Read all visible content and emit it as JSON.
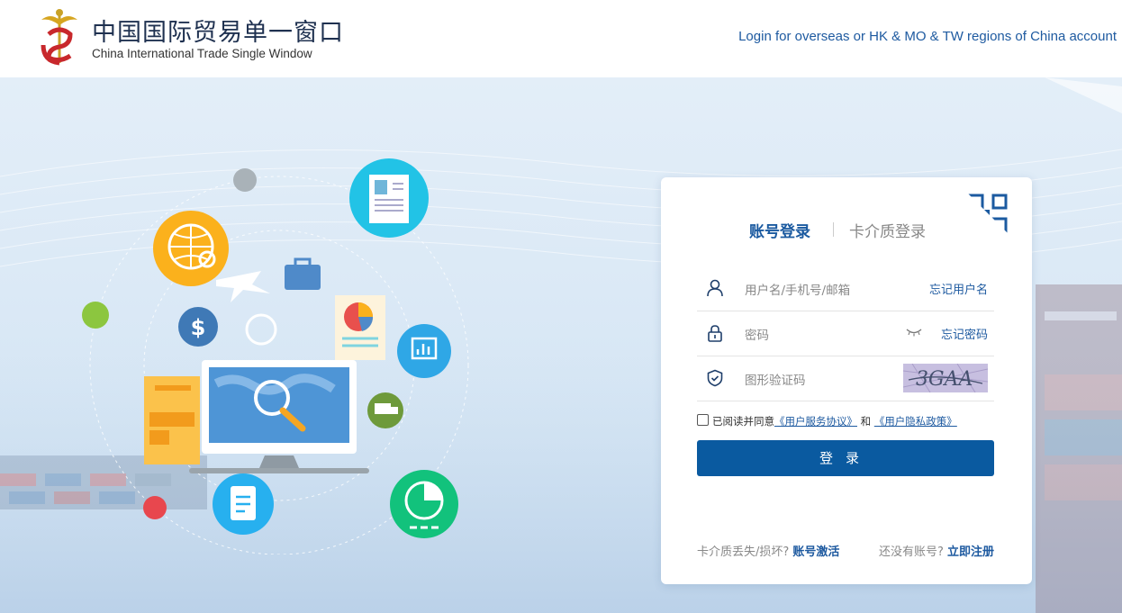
{
  "header": {
    "title_cn": "中国国际贸易单一窗口",
    "title_en": "China International Trade Single Window",
    "overseas_link": "Login for overseas or HK & MO & TW regions of China account"
  },
  "login": {
    "tab_account": "账号登录",
    "tab_card": "卡介质登录",
    "username_placeholder": "用户名/手机号/邮箱",
    "forgot_username": "忘记用户名",
    "password_placeholder": "密码",
    "forgot_password": "忘记密码",
    "captcha_placeholder": "图形验证码",
    "captcha_text": "3GAA",
    "agree_prefix": "已阅读并同意",
    "agree_terms": "《用户服务协议》",
    "agree_and": "和",
    "agree_privacy": "《用户隐私政策》",
    "login_button": "登录",
    "card_lost_text": "卡介质丢失/损坏?",
    "activate_link": "账号激活",
    "no_account_text": "还没有账号?",
    "register_link": "立即注册"
  },
  "colors": {
    "accent": "#0a5aa0",
    "link": "#1e5aa0"
  },
  "icons": {
    "logo": "caduceus-logo-icon",
    "qr": "qr-code-icon",
    "user": "user-icon",
    "lock": "lock-icon",
    "shield": "shield-check-icon",
    "eye": "eye-closed-icon"
  }
}
